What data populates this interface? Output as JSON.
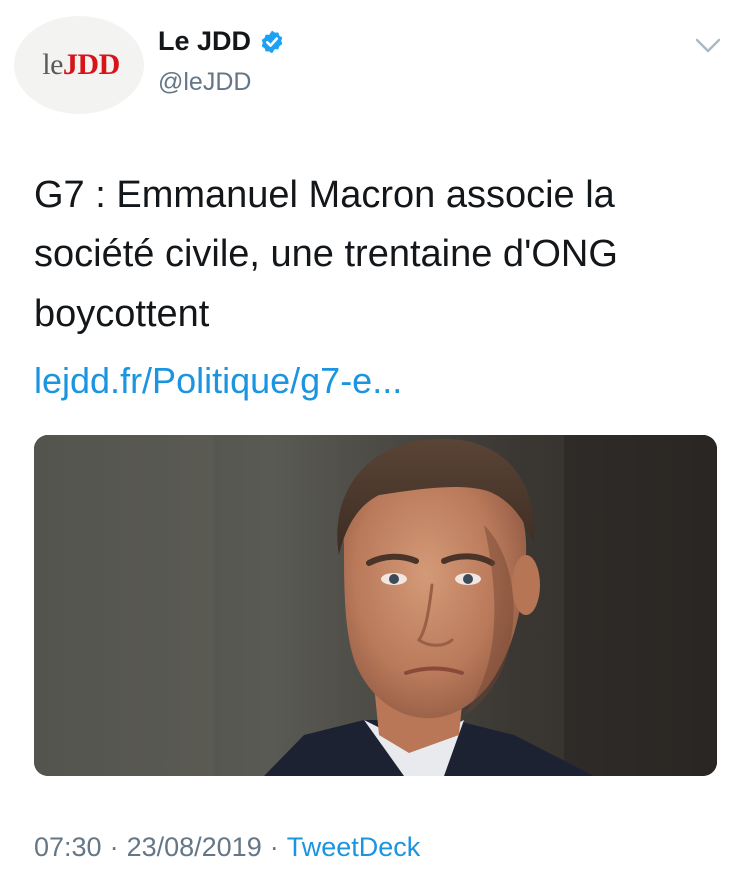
{
  "author": {
    "name": "Le JDD",
    "handle": "@leJDD",
    "logo": {
      "prefix": "le",
      "brand": "JDD",
      "brand_color": "#d7141a"
    },
    "verified": true,
    "verified_icon": "verified-badge-icon"
  },
  "menu_icon": "chevron-down-icon",
  "tweet": {
    "text": "G7 : Emmanuel Macron associe la société civile, une trentaine d'ONG boycottent",
    "link_text": "lejdd.fr/Politique/g7-e..."
  },
  "media": {
    "type": "photo"
  },
  "meta": {
    "time": "07:30",
    "separator": "·",
    "date": "23/08/2019",
    "source": "TweetDeck"
  },
  "colors": {
    "link": "#1b95e0",
    "secondary_text": "#657786",
    "primary_text": "#14171a"
  }
}
